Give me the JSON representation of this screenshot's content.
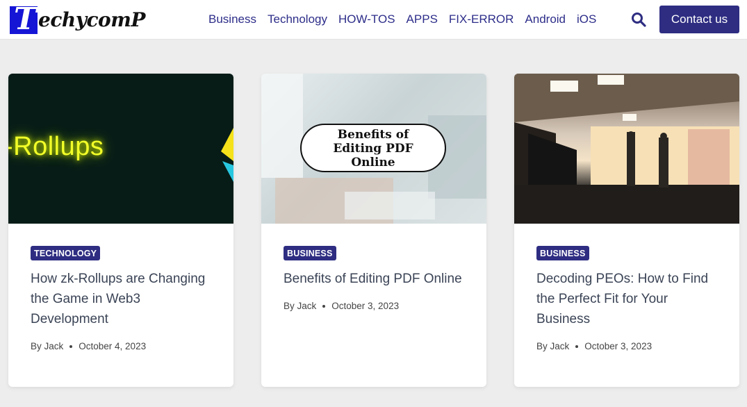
{
  "header": {
    "logo_first_letter": "T",
    "logo_rest": "echycomP",
    "nav": [
      "Business",
      "Technology",
      "HOW-TOS",
      "APPS",
      "FIX-ERROR",
      "Android",
      "iOS"
    ],
    "contact_label": "Contact us",
    "search_icon": "search-icon"
  },
  "colors": {
    "brand": "#2e2d82",
    "background": "#ededed",
    "logo_blue": "#1515d6"
  },
  "posts": [
    {
      "category": "TECHNOLOGY",
      "title": "How zk-Rollups are Changing the Game in Web3 Development",
      "author": "By Jack",
      "date": "October 4, 2023",
      "image_text": "-Rollups"
    },
    {
      "category": "BUSINESS",
      "title": "Benefits of Editing PDF Online",
      "author": "By Jack",
      "date": "October 3, 2023",
      "image_text_lines": [
        "Benefits of",
        "Editing PDF",
        "Online"
      ]
    },
    {
      "category": "BUSINESS",
      "title": "Decoding PEOs: How to Find the Perfect Fit for Your Business",
      "author": "By Jack",
      "date": "October 3, 2023"
    }
  ]
}
